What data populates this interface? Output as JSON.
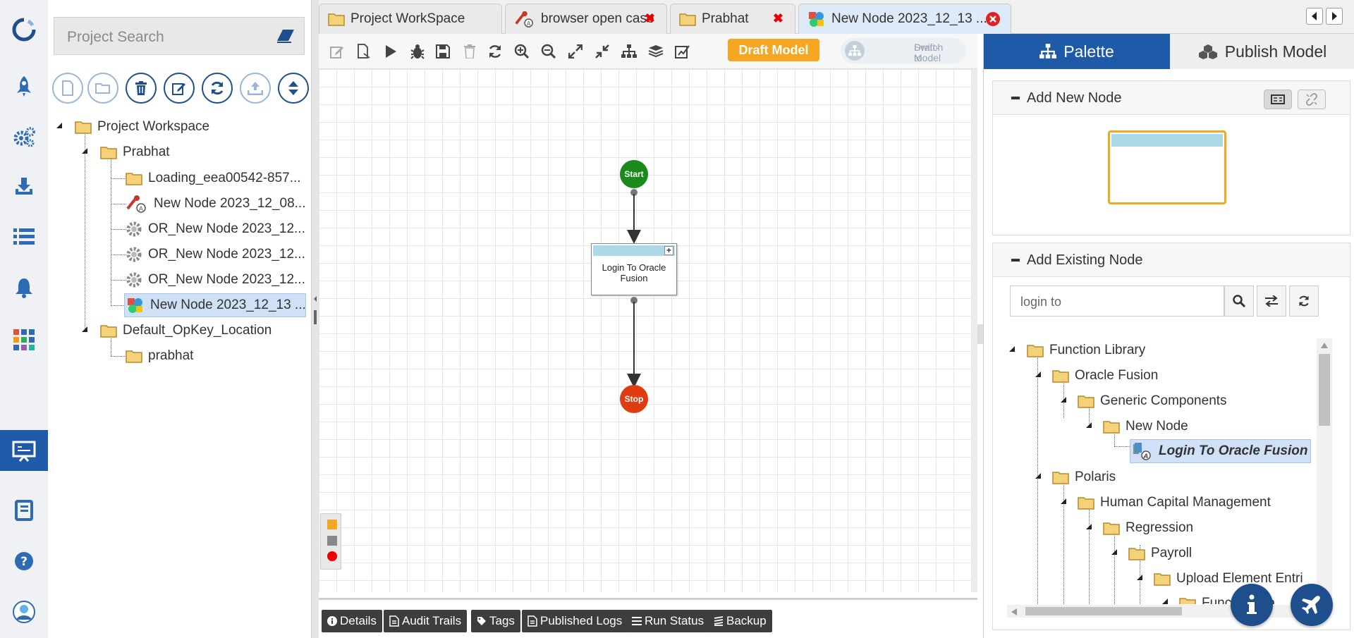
{
  "left_panel": {
    "search_placeholder": "Project Search",
    "tree": [
      {
        "label": "Project Workspace"
      },
      {
        "label": "Prabhat"
      },
      {
        "label": "Loading_eea00542-857..."
      },
      {
        "label": "New Node 2023_12_08..."
      },
      {
        "label": "OR_New Node 2023_12..."
      },
      {
        "label": "OR_New Node 2023_12..."
      },
      {
        "label": "OR_New Node 2023_12..."
      },
      {
        "label": "New Node 2023_12_13 ..."
      },
      {
        "label": "Default_OpKey_Location"
      },
      {
        "label": "prabhat"
      }
    ]
  },
  "tabs": [
    {
      "label": "Project WorkSpace"
    },
    {
      "label": "browser open case"
    },
    {
      "label": "Prabhat"
    },
    {
      "label": "New Node 2023_12_13 ..."
    }
  ],
  "toolbar": {
    "draft_label": "Draft Model",
    "switch_label_1": "Switch to",
    "switch_label_2": "Draft-Model"
  },
  "canvas": {
    "start_label": "Start",
    "node_label": "Login To Oracle Fusion",
    "stop_label": "Stop"
  },
  "bottom_tabs": [
    {
      "label": "Details"
    },
    {
      "label": "Audit Trails"
    },
    {
      "label": "Tags"
    },
    {
      "label": "Published Logs"
    },
    {
      "label": "Run Status"
    },
    {
      "label": "Backup"
    }
  ],
  "right_panel": {
    "tab_palette": "Palette",
    "tab_publish": "Publish Model",
    "add_new_title": "Add New Node",
    "add_existing_title": "Add Existing Node",
    "search_value": "login to",
    "tree": [
      {
        "label": "Function Library"
      },
      {
        "label": "Oracle Fusion"
      },
      {
        "label": "Generic Components"
      },
      {
        "label": "New Node"
      },
      {
        "label": "Login To Oracle Fusion"
      },
      {
        "label": "Polaris"
      },
      {
        "label": "Human Capital Management"
      },
      {
        "label": "Regression"
      },
      {
        "label": "Payroll"
      },
      {
        "label": "Upload Element Entri"
      },
      {
        "label": "Function Lib"
      }
    ]
  },
  "colors": {
    "brand_blue": "#1e4f8c",
    "active_blue": "#1e5aa8",
    "draft_orange": "#f5a623",
    "start_green": "#1a8a1a",
    "stop_red": "#e03c12"
  }
}
